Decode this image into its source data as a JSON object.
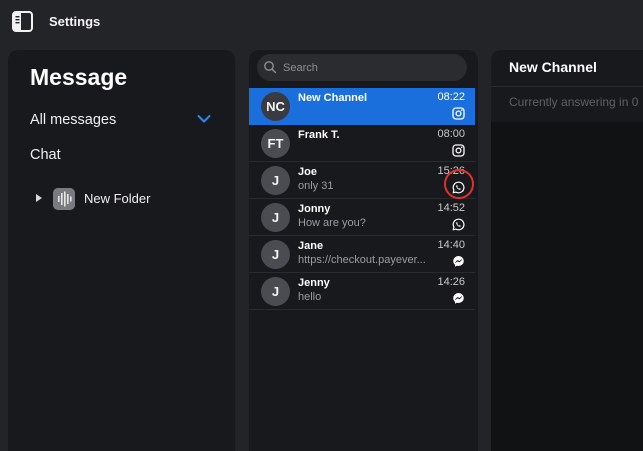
{
  "window": {
    "title": "Settings"
  },
  "left_panel": {
    "heading": "Message",
    "filter_label": "All messages",
    "chat_label": "Chat",
    "folder": {
      "label": "New Folder"
    }
  },
  "search": {
    "placeholder": "Search",
    "value": ""
  },
  "conversations": [
    {
      "initials": "NC",
      "name": "New Channel",
      "preview": "",
      "time": "08:22",
      "channel": "instagram-icon",
      "active": true
    },
    {
      "initials": "FT",
      "name": "Frank T.",
      "preview": "",
      "time": "08:00",
      "channel": "instagram-icon",
      "active": false
    },
    {
      "initials": "J",
      "name": "Joe",
      "preview": "only 31",
      "time": "15:26",
      "channel": "whatsapp-icon",
      "active": false,
      "highlighted": true
    },
    {
      "initials": "J",
      "name": "Jonny",
      "preview": "How are you?",
      "time": "14:52",
      "channel": "whatsapp-icon",
      "active": false
    },
    {
      "initials": "J",
      "name": "Jane",
      "preview": "https://checkout.payever...",
      "time": "14:40",
      "channel": "messenger-icon",
      "active": false
    },
    {
      "initials": "J",
      "name": "Jenny",
      "preview": "hello",
      "time": "14:26",
      "channel": "messenger-icon",
      "active": false
    }
  ],
  "detail": {
    "title": "New Channel",
    "status": "Currently answering in 0"
  },
  "colors": {
    "accent": "#1a6fdc",
    "highlight_ring": "#e0322a",
    "background": "#232428",
    "panel": "#18191c"
  }
}
